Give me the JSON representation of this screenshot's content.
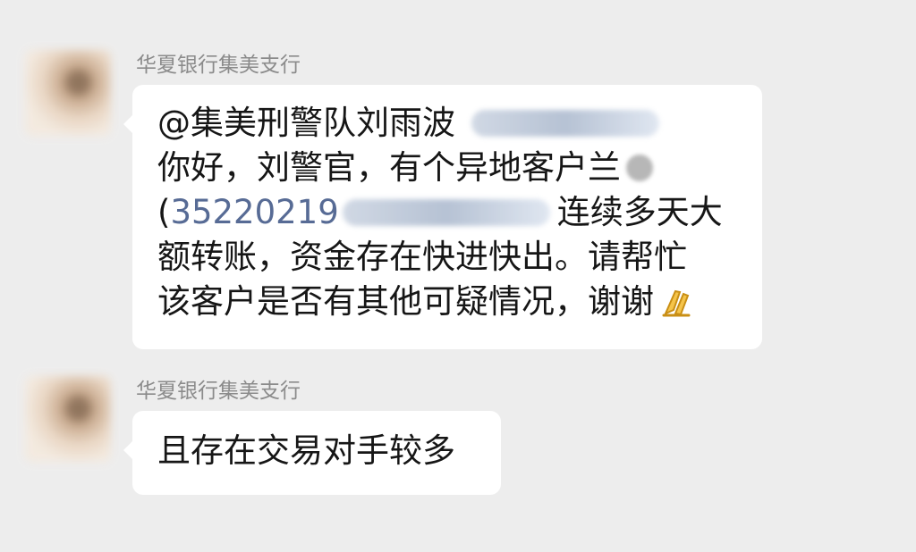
{
  "chat": {
    "messages": [
      {
        "sender": "华夏银行集美支行",
        "lines": [
          {
            "text": "@集美刑警队刘雨波"
          },
          {
            "text": "你好，刘警官，有个异地客户兰"
          },
          {
            "open": "(",
            "number": "35220219",
            "after": "连续多天大"
          },
          {
            "text": "额转账，资金存在快进快出。请帮忙"
          },
          {
            "text": "该客户是否有其他可疑情况，谢谢"
          }
        ],
        "emoji": "folded-hands-icon"
      },
      {
        "sender": "华夏银行集美支行",
        "lines": [
          {
            "text": "且存在交易对手较多"
          }
        ]
      }
    ]
  },
  "colors": {
    "background": "#ededed",
    "bubble": "#ffffff",
    "sender_text": "#8b8b8b",
    "message_text": "#161616",
    "link_text": "#576b95"
  }
}
